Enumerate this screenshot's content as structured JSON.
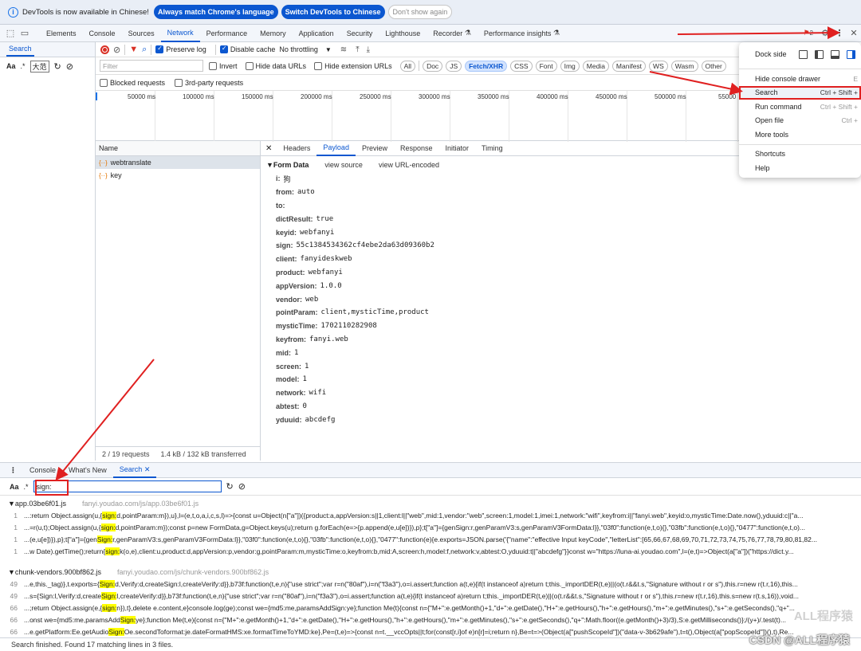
{
  "infobar": {
    "message": "DevTools is now available in Chinese!",
    "btn_match": "Always match Chrome's language",
    "btn_switch": "Switch DevTools to Chinese",
    "btn_dismiss": "Don't show again"
  },
  "main_tabs": [
    "Elements",
    "Console",
    "Sources",
    "Network",
    "Performance",
    "Memory",
    "Application",
    "Security",
    "Lighthouse",
    "Recorder",
    "Performance insights"
  ],
  "issues_badge": "2",
  "left_panel": {
    "title": "Search",
    "aa": "Aa",
    "regex": ".*",
    "placeholder_label": "大范"
  },
  "network_toolbar": {
    "preserve_log": "Preserve log",
    "disable_cache": "Disable cache",
    "throttling": "No throttling",
    "filter_placeholder": "Filter",
    "invert": "Invert",
    "hide_data_urls": "Hide data URLs",
    "hide_ext_urls": "Hide extension URLs",
    "types": [
      "All",
      "Doc",
      "JS",
      "Fetch/XHR",
      "CSS",
      "Font",
      "Img",
      "Media",
      "Manifest",
      "WS",
      "Wasm",
      "Other"
    ],
    "active_type": "Fetch/XHR",
    "blocked_requests": "Blocked requests",
    "third_party": "3rd-party requests"
  },
  "timeline_ticks": [
    "50000 ms",
    "100000 ms",
    "150000 ms",
    "200000 ms",
    "250000 ms",
    "300000 ms",
    "350000 ms",
    "400000 ms",
    "450000 ms",
    "500000 ms",
    "55000"
  ],
  "request_list": {
    "header": "Name",
    "items": [
      "webtranslate",
      "key"
    ],
    "footer_requests": "2 / 19 requests",
    "footer_transfer": "1.4 kB / 132 kB transferred"
  },
  "detail_tabs": [
    "Headers",
    "Payload",
    "Preview",
    "Response",
    "Initiator",
    "Timing"
  ],
  "form_data": {
    "title": "▼Form Data",
    "view_source": "view source",
    "view_url": "view URL-encoded",
    "fields": [
      {
        "k": "i:",
        "v": "狗"
      },
      {
        "k": "from:",
        "v": "auto"
      },
      {
        "k": "to:",
        "v": ""
      },
      {
        "k": "dictResult:",
        "v": "true"
      },
      {
        "k": "keyid:",
        "v": "webfanyi"
      },
      {
        "k": "sign:",
        "v": "55c1384534362cf4ebe2da63d09360b2"
      },
      {
        "k": "client:",
        "v": "fanyideskweb"
      },
      {
        "k": "product:",
        "v": "webfanyi"
      },
      {
        "k": "appVersion:",
        "v": "1.0.0"
      },
      {
        "k": "vendor:",
        "v": "web"
      },
      {
        "k": "pointParam:",
        "v": "client,mysticTime,product"
      },
      {
        "k": "mysticTime:",
        "v": "1702110282908"
      },
      {
        "k": "keyfrom:",
        "v": "fanyi.web"
      },
      {
        "k": "mid:",
        "v": "1"
      },
      {
        "k": "screen:",
        "v": "1"
      },
      {
        "k": "model:",
        "v": "1"
      },
      {
        "k": "network:",
        "v": "wifi"
      },
      {
        "k": "abtest:",
        "v": "0"
      },
      {
        "k": "yduuid:",
        "v": "abcdefg"
      }
    ]
  },
  "drawer": {
    "tabs": [
      "Console",
      "What's New",
      "Search"
    ],
    "search_value": "sign:",
    "aa": "Aa",
    "regex": ".*",
    "status": "Search finished.  Found 17 matching lines in 3 files."
  },
  "results": [
    {
      "file": "▼app.03be6f01.js",
      "url": "fanyi.youdao.com/js/app.03be6f01.js",
      "lines": [
        {
          "n": "1",
          "pre": "...:return Object.assign(u,{",
          "hit": "sign:",
          "post": "d,pointParam:m}),u},l=(e,t,o,a,i,c,s,l)=>{const u=Object(n[\"a\"])({product:a,appVersion:s||1,client:l||\"web\",mid:1,vendor:\"web\",screen:1,model:1,imei:1,network:\"wifi\",keyfrom:i||\"fanyi.web\",keyid:o,mysticTime:Date.now(),yduuid:c||\"a..."
        },
        {
          "n": "1",
          "pre": "...=r(u,t);Object.assign(u,{",
          "hit": "sign:",
          "post": "d,pointParam:m});const p=new FormData,g=Object.keys(u);return g.forEach(e=>{p.append(e,u[e])}),p};t[\"a\"]={genSign:r,genParamV3:s,genParamV3FormData:l}},\"03f0\":function(e,t,o){},\"03fb\":function(e,t,o){},\"0477\":function(e,t,o)..."
        },
        {
          "n": "1",
          "pre": "...(e,u[e])}),p};t[\"a\"]={gen",
          "hit": "Sign:",
          "post": "r,genParamV3:s,genParamV3FormData:l}},\"03f0\":function(e,t,o){},\"03fb\":function(e,t,o){},\"0477\":function(e){e.exports=JSON.parse('{\"name\":\"effective Input keyCode\",\"letterList\":[65,66,67,68,69,70,71,72,73,74,75,76,77,78,79,80,81,82..."
        },
        {
          "n": "1",
          "pre": "...w Date).getTime();return{",
          "hit": "sign:",
          "post": "k(o,e),client:u,product:d,appVersion:p,vendor:g,pointParam:m,mysticTime:o,keyfrom:b,mid:A,screen:h,model:f,network:v,abtest:O,yduuid:t||\"abcdefg\"}}const w=\"https://luna-ai.youdao.com\",l=(e,t)=>Object(a[\"a\"])(\"https://dict.y..."
        }
      ]
    },
    {
      "file": "▼chunk-vendors.900bf862.js",
      "url": "fanyi.youdao.com/js/chunk-vendors.900bf862.js",
      "lines": [
        {
          "n": "49",
          "pre": "...e,this._tag)},t.exports={",
          "hit": "Sign:",
          "post": "d,Verify:d,createSign:l,createVerify:d}},b73f:function(t,e,n){\"use strict\";var r=n(\"80af\"),i=n(\"f3a3\"),o=i.assert;function a(t,e){if(t instanceof a)return t;this._importDER(t,e)||(o(t.r&&t.s,\"Signature without r or s\"),this.r=new r(t.r,16),this..."
        },
        {
          "n": "49",
          "pre": "...s={Sign:l,Verify:d,create",
          "hit": "Sign:",
          "post": "l,createVerify:d}},b73f:function(t,e,n){\"use strict\";var r=n(\"80af\"),i=n(\"f3a3\"),o=i.assert;function a(t,e){if(t instanceof a)return t;this._importDER(t,e)||(o(t.r&&t.s,\"Signature without r or s\"),this.r=new r(t.r,16),this.s=new r(t.s,16)),void..."
        },
        {
          "n": "66",
          "pre": "...;return Object.assign(e,{",
          "hit": "sign:",
          "post": "n}),t},delete e.content,e}console.log(ge);const we={md5:me,paramsAddSign:ye};function Me(t){const n={\"M+\":e.getMonth()+1,\"d+\":e.getDate(),\"H+\":e.getHours(),\"h+\":e.getHours(),\"m+\":e.getMinutes(),\"s+\":e.getSeconds(),\"q+\"..."
        },
        {
          "n": "66",
          "pre": "...onst we={md5:me,paramsAdd",
          "hit": "Sign:",
          "post": "ye};function Me(t,e){const n={\"M+\":e.getMonth()+1,\"d+\":e.getDate(),\"H+\":e.getHours(),\"h+\":e.getHours(),\"m+\":e.getMinutes(),\"s+\":e.getSeconds(),\"q+\":Math.floor((e.getMonth()+3)/3),S:e.getMilliseconds()};/(y+)/.test(t)..."
        },
        {
          "n": "66",
          "pre": "...e.getPlatform:Ee.getAudio",
          "hit": "Sign:",
          "post": "Oe.secondToformat:je.dateFormatHMS:xe.formatTimeToYMD:ke},Pe=(t,e)=>{const n=t.__vccOpts||t;for(const[r,i]of e)n[r]=i;return n},Be=t=>(Object(a[\"pushScopeId\"])(\"data-v-3b629afe\"),t=t(),Object(a[\"popScopeId\"])(),t),Re..."
        }
      ]
    }
  ],
  "menu": {
    "dock_side": "Dock side",
    "items": [
      {
        "label": "Hide console drawer",
        "shortcut": "E"
      },
      {
        "label": "Search",
        "shortcut": "Ctrl + Shift +"
      },
      {
        "label": "Run command",
        "shortcut": "Ctrl + Shift +"
      },
      {
        "label": "Open file",
        "shortcut": "Ctrl +"
      },
      {
        "label": "More tools",
        "shortcut": ""
      }
    ],
    "items2": [
      {
        "label": "Shortcuts"
      },
      {
        "label": "Help"
      }
    ]
  },
  "watermark": "CSDN @ALL程序猿",
  "watermark2": "ALL程序猿",
  "colors": {
    "accent": "#0b57d0",
    "annotation_red": "#e02020",
    "highlight": "#ffff00"
  }
}
